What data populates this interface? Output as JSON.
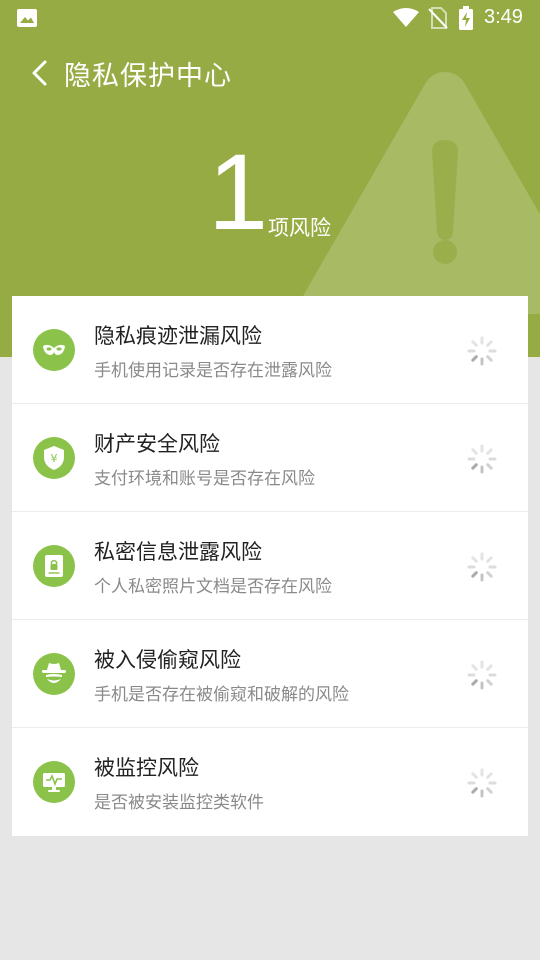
{
  "status_bar": {
    "time": "3:49",
    "icons": [
      "image-icon",
      "wifi-icon",
      "no-sim-icon",
      "battery-charging-icon"
    ]
  },
  "header": {
    "back_icon": "chevron-left-icon",
    "title": "隐私保护中心",
    "risk_count": "1",
    "risk_unit": "项风险",
    "background_icon": "warning-triangle-icon"
  },
  "colors": {
    "header_bg": "#96ab44",
    "icon_bg": "#8bc34a",
    "page_bg": "#e6e6e6"
  },
  "risks": [
    {
      "title": "隐私痕迹泄漏风险",
      "subtitle": "手机使用记录是否存在泄露风险",
      "icon": "mask-icon"
    },
    {
      "title": "财产安全风险",
      "subtitle": "支付环境和账号是否存在风险",
      "icon": "shield-yen-icon"
    },
    {
      "title": "私密信息泄露风险",
      "subtitle": "个人私密照片文档是否存在风险",
      "icon": "lock-document-icon"
    },
    {
      "title": "被入侵偷窥风险",
      "subtitle": "手机是否存在被偷窥和破解的风险",
      "icon": "spy-icon"
    },
    {
      "title": "被监控风险",
      "subtitle": "是否被安装监控类软件",
      "icon": "monitor-icon"
    }
  ]
}
